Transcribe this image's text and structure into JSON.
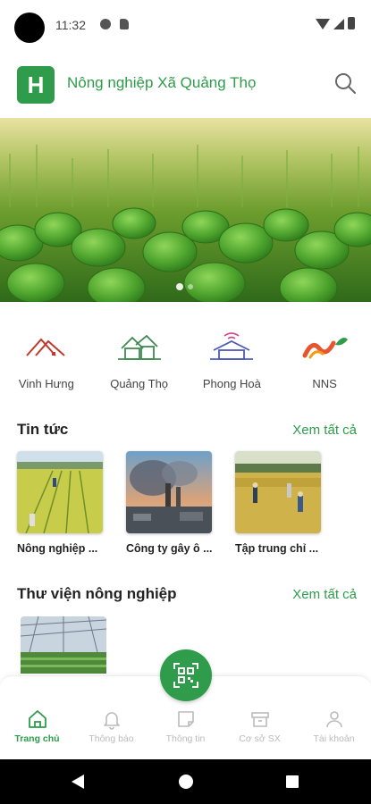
{
  "status_bar": {
    "time": "11:32"
  },
  "header": {
    "logo_letter": "H",
    "title": "Nông nghiệp Xã Quảng Thọ",
    "search_icon": "search-icon"
  },
  "communes": [
    {
      "label": "Vinh Hưng",
      "icon": "roof-icon",
      "color": "#c0392b"
    },
    {
      "label": "Quảng Thọ",
      "icon": "house-icon",
      "color": "#3f8a4f"
    },
    {
      "label": "Phong Hoà",
      "icon": "house-wifi-icon",
      "color": "#4b5bb5"
    },
    {
      "label": "NNS",
      "icon": "nns-logo-icon",
      "color": "#e8542f"
    }
  ],
  "news": {
    "title": "Tin tức",
    "see_all": "Xem tất cả",
    "items": [
      {
        "title": "Nông nghiệp ..."
      },
      {
        "title": "Công ty gây ô ..."
      },
      {
        "title": "Tập trung chỉ ..."
      }
    ]
  },
  "library": {
    "title": "Thư viện nông nghiệp",
    "see_all": "Xem tất cả"
  },
  "bottom_nav": [
    {
      "label": "Trang chủ",
      "icon": "home-icon",
      "active": true
    },
    {
      "label": "Thông báo",
      "icon": "bell-icon",
      "active": false
    },
    {
      "label": "Thông tin",
      "icon": "note-icon",
      "active": false
    },
    {
      "label": "Cơ sở SX",
      "icon": "box-icon",
      "active": false
    },
    {
      "label": "Tài khoản",
      "icon": "user-icon",
      "active": false
    }
  ],
  "colors": {
    "brand": "#2e9c4a",
    "inactive": "#bbbbbb"
  }
}
